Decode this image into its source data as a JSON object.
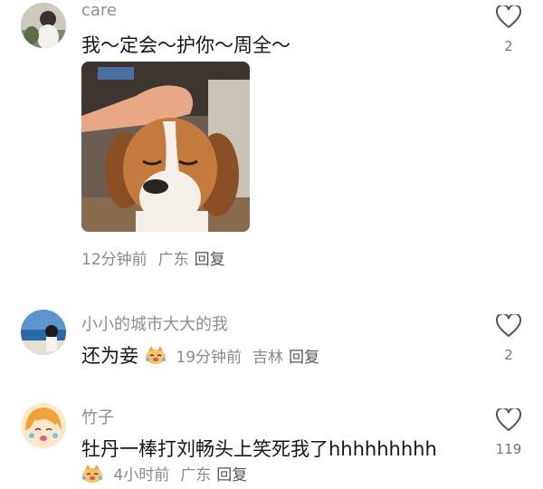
{
  "comments": [
    {
      "username": "care",
      "text": "我～定会～护你～周全～",
      "time": "12分钟前",
      "location": "广东",
      "reply_label": "回复",
      "likes": "2",
      "image": "beagle-being-petted-photo"
    },
    {
      "username": "小小的城市大大的我",
      "text": "还为妾",
      "time": "19分钟前",
      "location": "吉林",
      "reply_label": "回复",
      "likes": "2",
      "emoji": "laughing-cat-emoji"
    },
    {
      "username": "竹子",
      "text": "牡丹一棒打刘畅头上笑死我了hhhhhhhhh",
      "time": "4小时前",
      "location": "广东",
      "reply_label": "回复",
      "likes": "119",
      "emoji": "laughing-cat-emoji"
    }
  ],
  "icons": {
    "like": "heart-outline-icon"
  },
  "colors": {
    "text": "#161616",
    "secondary": "#8e8e8e"
  }
}
